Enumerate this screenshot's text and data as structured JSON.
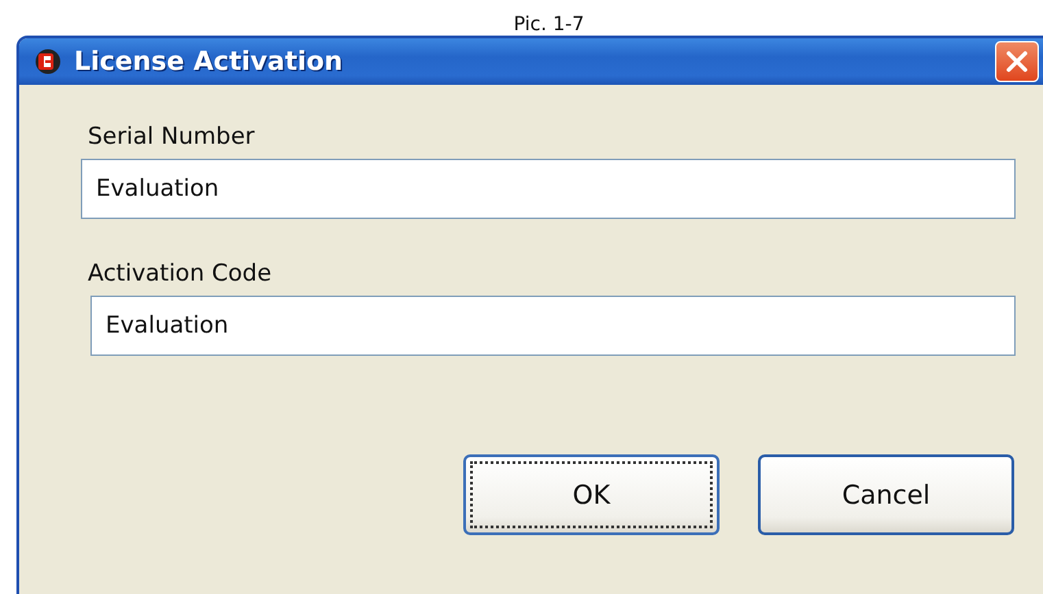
{
  "caption": "Pic. 1-7",
  "window": {
    "title": "License Activation"
  },
  "fields": [
    {
      "label": "Serial Number",
      "value": "Evaluation"
    },
    {
      "label": "Activation Code",
      "value": "Evaluation"
    }
  ],
  "buttons": [
    {
      "label": "OK",
      "focused": true
    },
    {
      "label": "Cancel",
      "focused": false
    }
  ]
}
